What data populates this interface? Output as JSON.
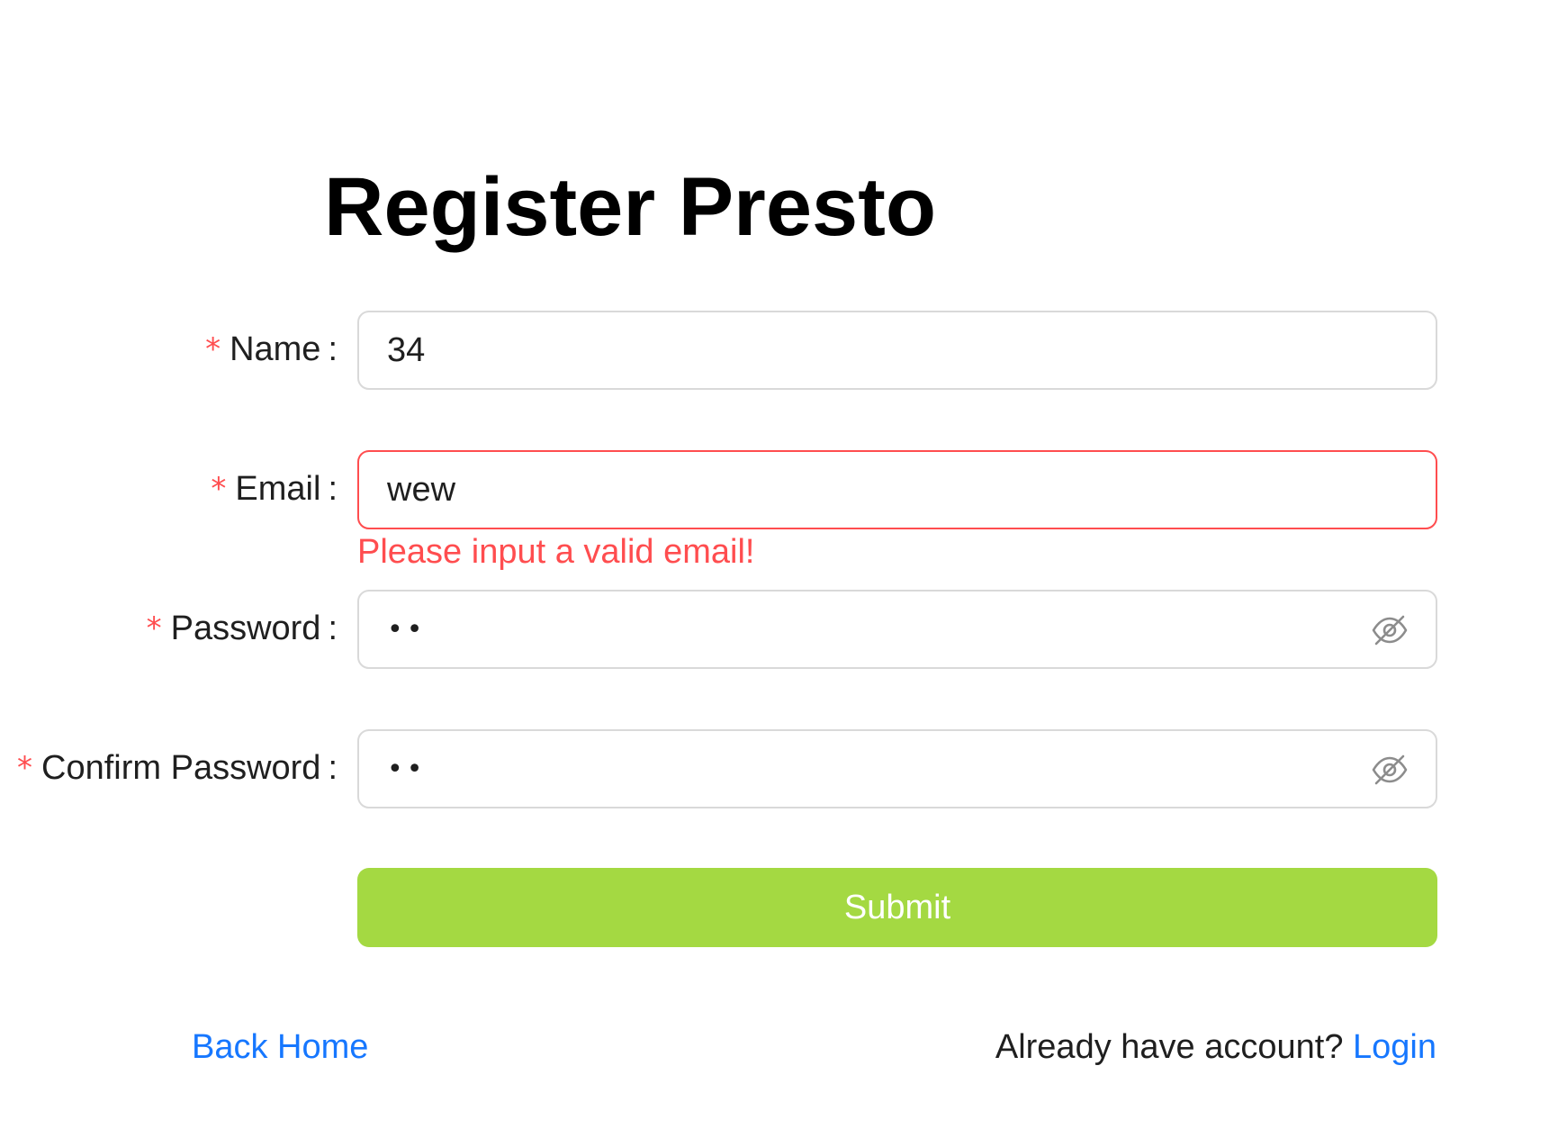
{
  "page": {
    "title": "Register Presto"
  },
  "form": {
    "required_mark": "*",
    "colon": ":",
    "name": {
      "label": "Name",
      "value": "34"
    },
    "email": {
      "label": "Email",
      "value": "wew",
      "error": "Please input a valid email!"
    },
    "password": {
      "label": "Password",
      "masked_value": "••",
      "toggle_icon": "eye-invisible-icon"
    },
    "confirm_password": {
      "label": "Confirm Password",
      "masked_value": "••",
      "toggle_icon": "eye-invisible-icon"
    },
    "submit_label": "Submit"
  },
  "footer": {
    "back_home": "Back Home",
    "already_text": "Already have account?",
    "login_link": "Login"
  },
  "colors": {
    "primary_button": "#a4d942",
    "error": "#ff4d4f",
    "link": "#1677ff",
    "border": "#d9d9d9"
  }
}
